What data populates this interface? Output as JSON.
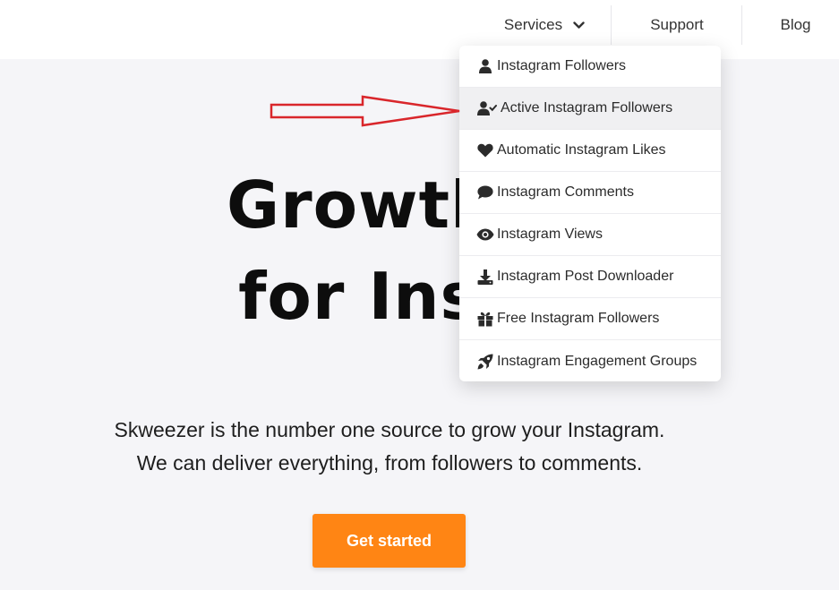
{
  "nav": {
    "services_label": "Services",
    "support_label": "Support",
    "blog_label": "Blog"
  },
  "dropdown": {
    "items": [
      {
        "label": "Instagram Followers",
        "icon": "user-icon"
      },
      {
        "label": "Active Instagram Followers",
        "icon": "user-check-icon",
        "highlighted": true
      },
      {
        "label": "Automatic Instagram Likes",
        "icon": "heart-icon"
      },
      {
        "label": "Instagram Comments",
        "icon": "comment-icon"
      },
      {
        "label": "Instagram Views",
        "icon": "eye-icon"
      },
      {
        "label": "Instagram Post Downloader",
        "icon": "download-icon"
      },
      {
        "label": "Free Instagram Followers",
        "icon": "gift-icon"
      },
      {
        "label": "Instagram Engagement Groups",
        "icon": "rocket-icon"
      }
    ]
  },
  "hero": {
    "title_line1": "Growth Se",
    "title_line2": "for Instag",
    "subtitle_line1": "Skweezer is the number one source to grow your Instagram.",
    "subtitle_line2": "We can deliver everything, from followers to comments.",
    "cta_label": "Get started"
  },
  "colors": {
    "accent": "#ff8514",
    "background": "#f5f5f8",
    "annotation_arrow": "#d9262b"
  }
}
